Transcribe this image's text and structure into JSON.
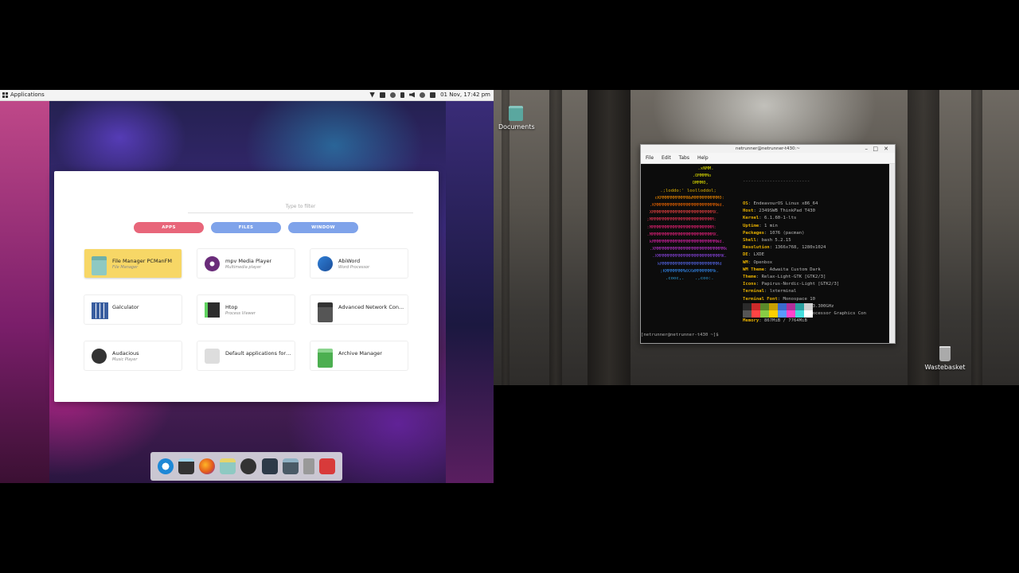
{
  "left_panel": {
    "menu_label": "Applications",
    "clock": "01 Nov, 17:42 pm",
    "launcher": {
      "filter_placeholder": "Type to filter",
      "tabs": [
        "APPS",
        "FILES",
        "WINDOW"
      ],
      "apps": [
        {
          "name": "File Manager PCManFM",
          "sub": "File Manager",
          "icon": "file-manager-icon",
          "selected": true
        },
        {
          "name": "mpv Media Player",
          "sub": "Multimedia player",
          "icon": "mpv-icon",
          "selected": false
        },
        {
          "name": "AbiWord",
          "sub": "Word Processor",
          "icon": "abiword-icon",
          "selected": false
        },
        {
          "name": "Galculator",
          "sub": "",
          "icon": "calculator-icon",
          "selected": false
        },
        {
          "name": "Htop",
          "sub": "Process Viewer",
          "icon": "htop-icon",
          "selected": false
        },
        {
          "name": "Advanced Network Con...",
          "sub": "",
          "icon": "network-icon",
          "selected": false
        },
        {
          "name": "Audacious",
          "sub": "Music Player",
          "icon": "audacious-icon",
          "selected": false
        },
        {
          "name": "Default applications for ...",
          "sub": "",
          "icon": "default-apps-icon",
          "selected": false
        },
        {
          "name": "Archive Manager",
          "sub": "",
          "icon": "archive-icon",
          "selected": false
        }
      ]
    },
    "dock": [
      "search-icon",
      "terminal-icon",
      "firefox-icon",
      "file-manager-icon",
      "audacious-icon",
      "console-icon",
      "settings-icon",
      "trash-icon",
      "screenshot-icon"
    ]
  },
  "right_panel": {
    "desktop_icons": {
      "documents": "Documents",
      "wastebasket": "Wastebasket"
    },
    "terminal": {
      "title": "netrunner@netrunner-t430:~",
      "menu": [
        "File",
        "Edit",
        "Tabs",
        "Help"
      ],
      "separator": "-------------------------",
      "info": [
        {
          "k": "OS",
          "v": "EndeavourOS Linux x86_64"
        },
        {
          "k": "Host",
          "v": "2349SWB ThinkPad T430"
        },
        {
          "k": "Kernel",
          "v": "6.1.60-1-lts"
        },
        {
          "k": "Uptime",
          "v": "1 min"
        },
        {
          "k": "Packages",
          "v": "1076 (pacman)"
        },
        {
          "k": "Shell",
          "v": "bash 5.2.15"
        },
        {
          "k": "Resolution",
          "v": "1366x768, 1280x1024"
        },
        {
          "k": "DE",
          "v": "LXDE"
        },
        {
          "k": "WM",
          "v": "Openbox"
        },
        {
          "k": "WM Theme",
          "v": "Adwaita Custom Dark"
        },
        {
          "k": "Theme",
          "v": "Relax-Light-GTK [GTK2/3]"
        },
        {
          "k": "Icons",
          "v": "Papirus-Nordic-Light [GTK2/3]"
        },
        {
          "k": "Terminal",
          "v": "lxterminal"
        },
        {
          "k": "Terminal Font",
          "v": "Monospace 10"
        },
        {
          "k": "CPU",
          "v": "Intel i5-3320M (2) @ 3.300GHz"
        },
        {
          "k": "GPU",
          "v": "Intel 3rd Gen Core processor Graphics Con"
        },
        {
          "k": "Memory",
          "v": "867MiB / 7764MiB"
        }
      ],
      "logo_lines": [
        "                    .xNMM.",
        "                  .OMMMMo",
        "                  OMMM0,",
        "      .;loddo:' loolloddol;",
        "    cKMMMMMMMMMMNWMMMMMMMMMM0:",
        "  .KMMMMMMMMMMMMMMMMMMMMMMMWd.",
        "  XMMMMMMMMMMMMMMMMMMMMMMMX.",
        " ;MMMMMMMMMMMMMMMMMMMMMMMM:",
        " :MMMMMMMMMMMMMMMMMMMMMMMM:",
        " .MMMMMMMMMMMMMMMMMMMMMMMMX.",
        "  kMMMMMMMMMMMMMMMMMMMMMMMMWd.",
        "  .XMMMMMMMMMMMMMMMMMMMMMMMMMMk",
        "   .XMMMMMMMMMMMMMMMMMMMMMMMMK.",
        "     kMMMMMMMMMMMMMMMMMMMMMMd",
        "      ;KMMMMMMMWXXWMMMMMMMk.",
        "        .cooc,.    .,coo:."
      ],
      "prompt": "[netrunner@netrunner-t430 ~]$ ",
      "swatch_colors": [
        "#2a2a2a",
        "#cc2a2a",
        "#5a8a2a",
        "#c8a000",
        "#3a6acc",
        "#b0309a",
        "#2aa0a0",
        "#d0d0d0",
        "#555555",
        "#ff4444",
        "#88cc44",
        "#ffd000",
        "#5a9aff",
        "#ff44cc",
        "#44dddd",
        "#ffffff"
      ]
    }
  }
}
